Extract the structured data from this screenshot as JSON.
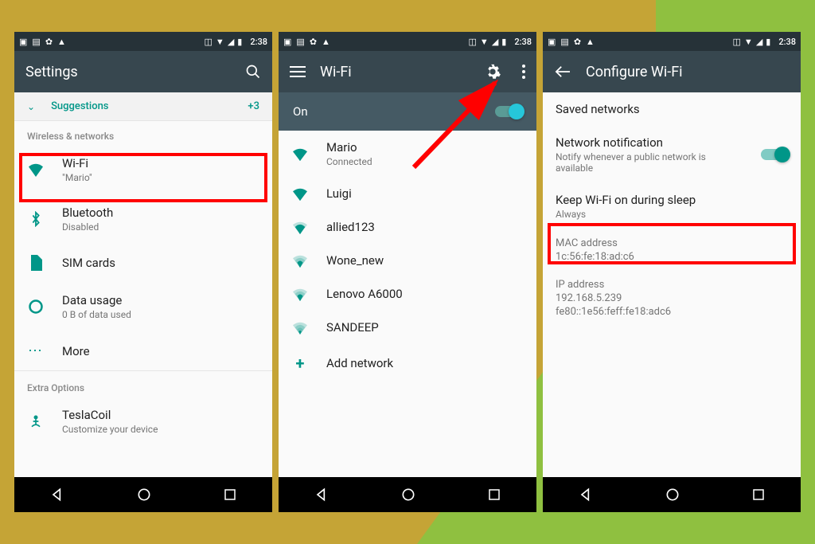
{
  "status": {
    "time": "2:38"
  },
  "screen1": {
    "title": "Settings",
    "suggestions": {
      "label": "Suggestions",
      "count": "+3"
    },
    "section_wireless": "Wireless & networks",
    "items": {
      "wifi": {
        "label": "Wi-Fi",
        "sub": "\"Mario\""
      },
      "bluetooth": {
        "label": "Bluetooth",
        "sub": "Disabled"
      },
      "sim": {
        "label": "SIM cards"
      },
      "data": {
        "label": "Data usage",
        "sub": "0 B of data used"
      },
      "more": {
        "label": "More"
      }
    },
    "section_extra": "Extra Options",
    "tesla": {
      "label": "TeslaCoil",
      "sub": "Customize your device"
    }
  },
  "screen2": {
    "title": "Wi-Fi",
    "on_label": "On",
    "networks": [
      {
        "name": "Mario",
        "sub": "Connected",
        "strength": 4
      },
      {
        "name": "Luigi",
        "strength": 4
      },
      {
        "name": "allied123",
        "strength": 3
      },
      {
        "name": "Wone_new",
        "strength": 2
      },
      {
        "name": "Lenovo A6000",
        "strength": 2
      },
      {
        "name": "SANDEEP",
        "strength": 1
      }
    ],
    "add_label": "Add network"
  },
  "screen3": {
    "title": "Configure Wi-Fi",
    "saved": "Saved networks",
    "notif": {
      "label": "Network notification",
      "sub": "Notify whenever a public network is available"
    },
    "keep": {
      "label": "Keep Wi-Fi on during sleep",
      "sub": "Always"
    },
    "mac": {
      "label": "MAC address",
      "value": "1c:56:fe:18:ad:c6"
    },
    "ip": {
      "label": "IP address",
      "value1": "192.168.5.239",
      "value2": "fe80::1e56:feff:fe18:adc6"
    }
  }
}
